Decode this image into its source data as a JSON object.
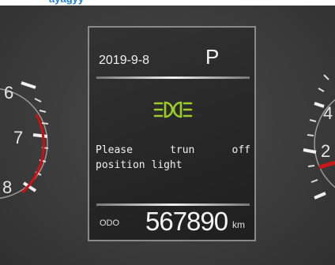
{
  "header_fragment": "ayagyy",
  "left_gauge": {
    "labels": [
      "6",
      "7",
      "8"
    ]
  },
  "right_gauge": {
    "labels": [
      "4",
      "2"
    ]
  },
  "panel": {
    "date": "2019-9-8",
    "gear": "P",
    "indicator_icon": "position-light-icon",
    "indicator_color": "#9ccc2a",
    "warning_line1_words": [
      "Please",
      "trun",
      "off"
    ],
    "warning_line2": "position light",
    "odo_label": "ODO",
    "odo_value": "567890",
    "odo_unit": "km"
  },
  "colors": {
    "redline": "#d01010",
    "needle": "#c81818"
  }
}
